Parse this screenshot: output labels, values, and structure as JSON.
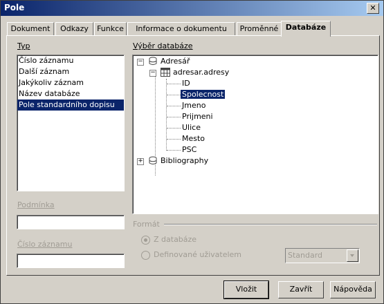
{
  "window": {
    "title": "Pole",
    "close_glyph": "✕"
  },
  "tabs": [
    {
      "label": "Dokument"
    },
    {
      "label": "Odkazy"
    },
    {
      "label": "Funkce"
    },
    {
      "label": "Informace o dokumentu"
    },
    {
      "label": "Proměnné"
    },
    {
      "label": "Databáze",
      "active": true
    }
  ],
  "typ": {
    "label": "Typ",
    "items": [
      "Číslo záznamu",
      "Další záznam",
      "Jakýkoliv záznam",
      "Název databáze",
      "Pole standardního dopisu"
    ],
    "selected_index": 4
  },
  "database": {
    "label": "Výběr databáze",
    "tree": {
      "root1": "Adresář",
      "table": "adresar.adresy",
      "fields": [
        "ID",
        "Spolecnost",
        "Jmeno",
        "Prijmeni",
        "Ulice",
        "Mesto",
        "PSC"
      ],
      "selected_field": "Spolecnost",
      "root2": "Bibliography"
    }
  },
  "condition": {
    "label": "Podmínka",
    "value": ""
  },
  "record_number": {
    "label": "Číslo záznamu",
    "value": ""
  },
  "format": {
    "label": "Formát",
    "option1": "Z databáze",
    "option2": "Definované uživatelem",
    "combo_value": "Standard"
  },
  "buttons": {
    "insert": "Vložit",
    "close": "Zavřít",
    "help": "Nápověda"
  },
  "colors": {
    "titlebar": "#0a246a",
    "selection": "#0a246a",
    "face": "#d4d0c8"
  }
}
